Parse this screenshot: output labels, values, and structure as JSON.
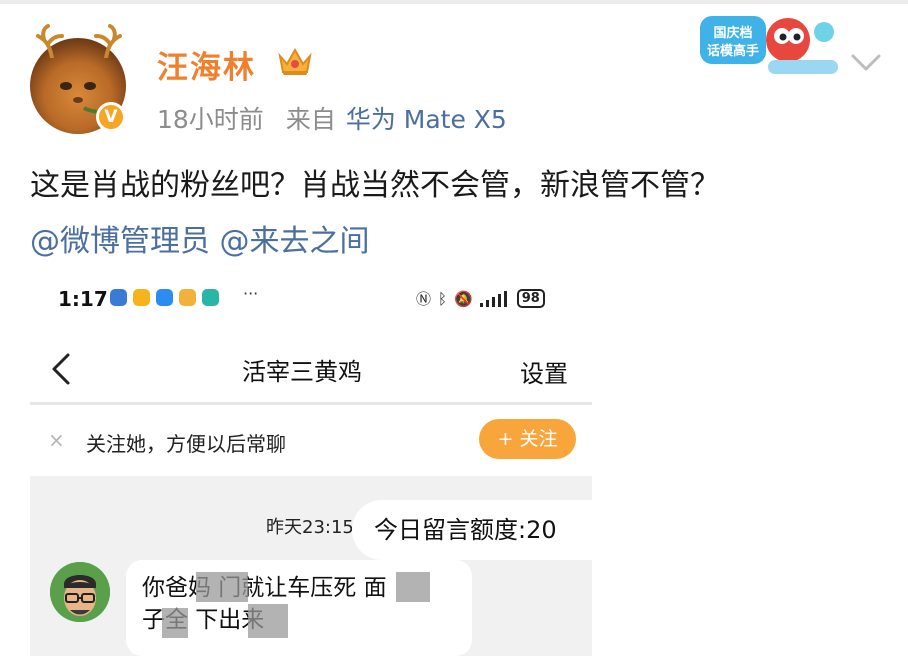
{
  "post": {
    "username": "汪海林",
    "time": "18小时前",
    "source_label": "来自",
    "device": "华为 Mate X5",
    "text": "这是肖战的粉丝吧？肖战当然不会管，新浪管不管？",
    "mentions": [
      "@微博管理员",
      "@来去之间"
    ],
    "sticker_label": "国庆档 话模高手",
    "badge": "V"
  },
  "screenshot": {
    "status_bar": {
      "time": "1:17",
      "battery": "98"
    },
    "nav": {
      "title": "活宰三黄鸡",
      "settings": "设置"
    },
    "follow_bar": {
      "close": "×",
      "text": "关注她，方便以后常聊",
      "button": "+ 关注"
    },
    "chat": {
      "timestamp": "昨天23:15",
      "quota": "今日留言额度:20",
      "message_line1": "你爸妈  门就让车压死  面",
      "message_line2": "  子全  下出来"
    }
  },
  "colors": {
    "accent_orange": "#f0802d",
    "link_blue": "#4a6fa0",
    "follow_button": "#f8a63b"
  }
}
